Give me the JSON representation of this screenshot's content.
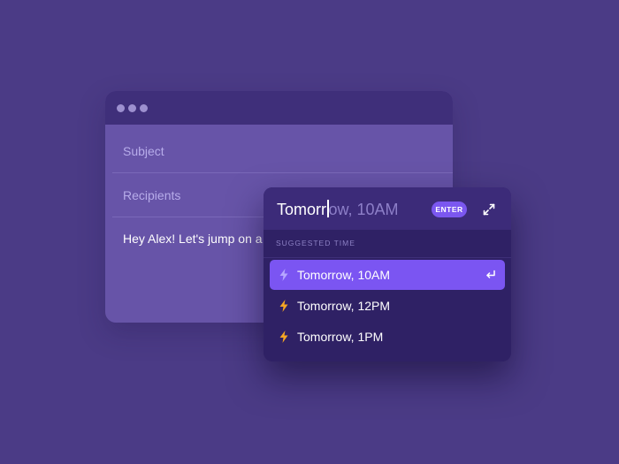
{
  "compose": {
    "subject_label": "Subject",
    "recipients_label": "Recipients",
    "body_text": "Hey Alex! Let's jump on a"
  },
  "scheduler": {
    "input_typed": "Tomorr",
    "input_completion": "ow, 10AM",
    "enter_label": "ENTER",
    "section_label": "SUGGESTED TIME",
    "options": [
      {
        "label": "Tomorrow, 10AM",
        "selected": true
      },
      {
        "label": "Tomorrow, 12PM",
        "selected": false
      },
      {
        "label": "Tomorrow, 1PM",
        "selected": false
      }
    ]
  },
  "colors": {
    "background": "#4b3b86",
    "accent": "#7b55f2",
    "bolt_selected": "#b6a6ff",
    "bolt": "#f5a623"
  },
  "icons": {
    "expand": "expand-icon",
    "bolt": "bolt-icon",
    "return": "return-icon"
  }
}
